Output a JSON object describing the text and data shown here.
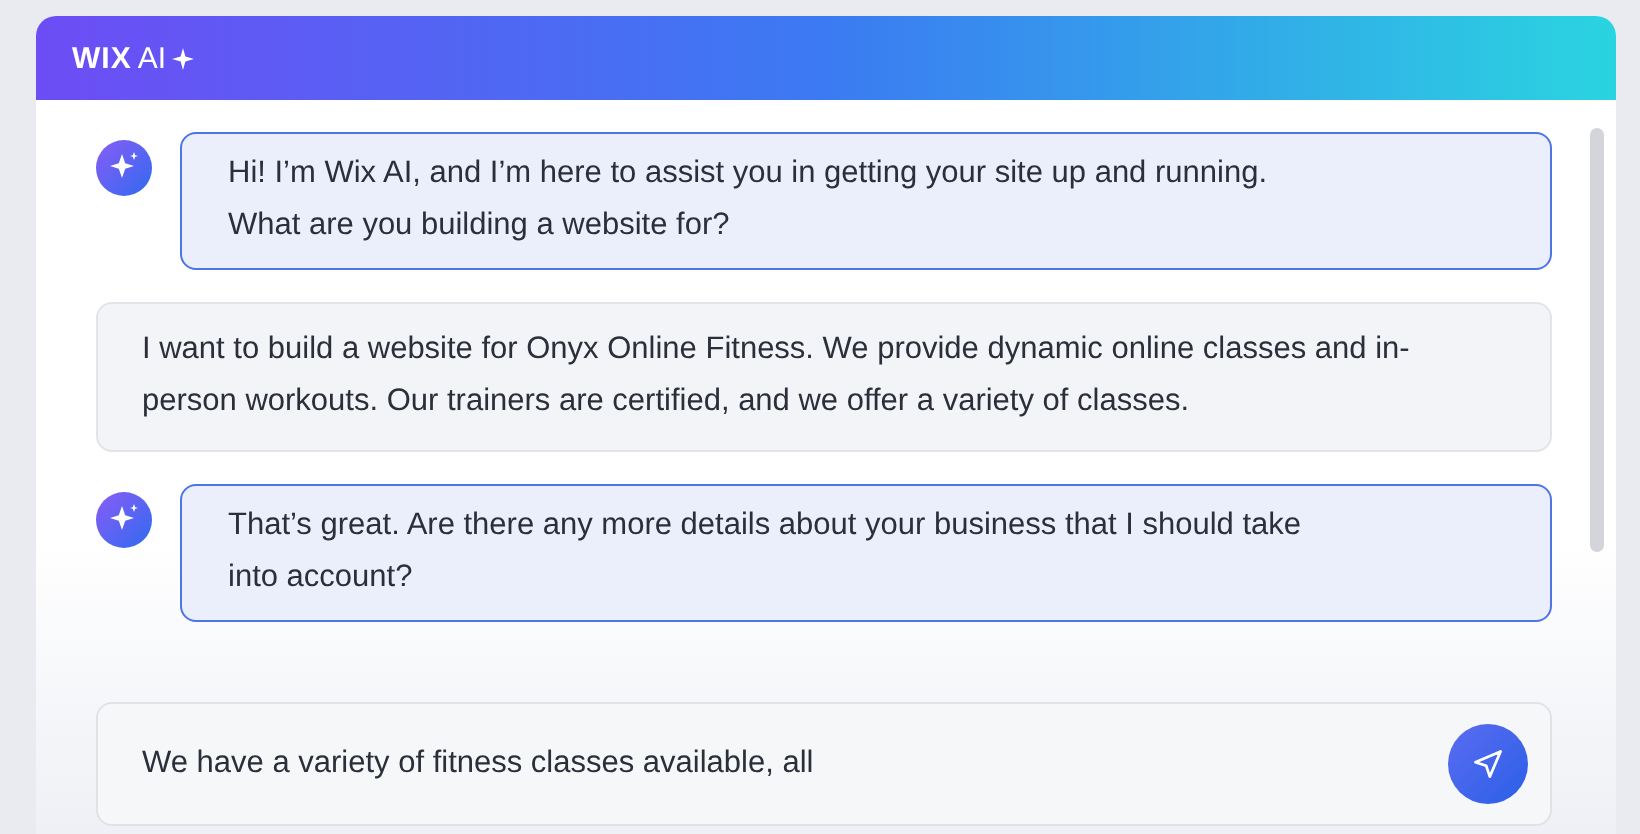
{
  "header": {
    "logo": "WIX",
    "logo_suffix": "AI"
  },
  "messages": [
    {
      "kind": "ai",
      "text": "Hi! I’m Wix AI, and I’m here to assist you in getting your site up and running. What are you building a website for?"
    },
    {
      "kind": "user",
      "text": "I want to build a website for Onyx Online Fitness. We provide dynamic online classes and in-person workouts. Our trainers are certified, and we offer a variety of classes."
    },
    {
      "kind": "ai",
      "text": "That’s great. Are there any more details about your business that I should take into account?"
    }
  ],
  "input": {
    "value": "We have a variety of fitness classes available, all"
  }
}
